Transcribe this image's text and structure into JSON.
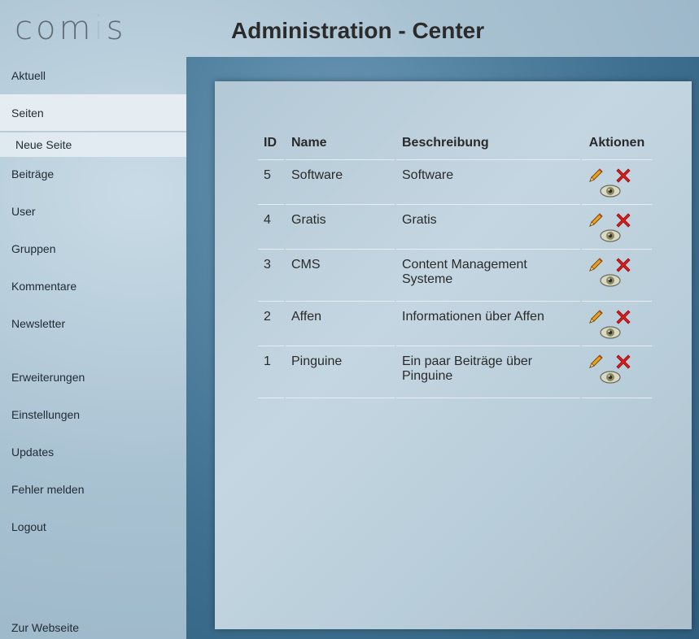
{
  "header": {
    "logo": {
      "part1": "co",
      "part2": "m",
      "part3": "i",
      "part4": "s"
    },
    "title": "Administration - Center"
  },
  "sidebar": {
    "items": [
      {
        "label": "Aktuell"
      },
      {
        "label": "Seiten",
        "active": true
      },
      {
        "label": "Beiträge"
      },
      {
        "label": "User"
      },
      {
        "label": "Gruppen"
      },
      {
        "label": "Kommentare"
      },
      {
        "label": "Newsletter"
      },
      {
        "label": "Erweiterungen"
      },
      {
        "label": "Einstellungen"
      },
      {
        "label": "Updates"
      },
      {
        "label": "Fehler melden"
      },
      {
        "label": "Logout"
      }
    ],
    "subitem": {
      "label": "Neue Seite"
    },
    "footer_link": "Zur Webseite"
  },
  "table": {
    "columns": {
      "id": "ID",
      "name": "Name",
      "desc": "Beschreibung",
      "actions": "Aktionen"
    },
    "rows": [
      {
        "id": "5",
        "name": "Software",
        "desc": "Software"
      },
      {
        "id": "4",
        "name": "Gratis",
        "desc": "Gratis"
      },
      {
        "id": "3",
        "name": "CMS",
        "desc": "Content Management Systeme"
      },
      {
        "id": "2",
        "name": "Affen",
        "desc": "Informationen über Affen"
      },
      {
        "id": "1",
        "name": "Pinguine",
        "desc": "Ein paar Beiträge über Pinguine"
      }
    ]
  },
  "icons": {
    "edit": "pencil-icon",
    "delete": "delete-x-icon",
    "view": "eye-icon"
  },
  "colors": {
    "active_nav_bg": "#e6edf2",
    "content_frame": "#3f708f",
    "delete": "#e02020",
    "pencil": "#e0a020"
  }
}
